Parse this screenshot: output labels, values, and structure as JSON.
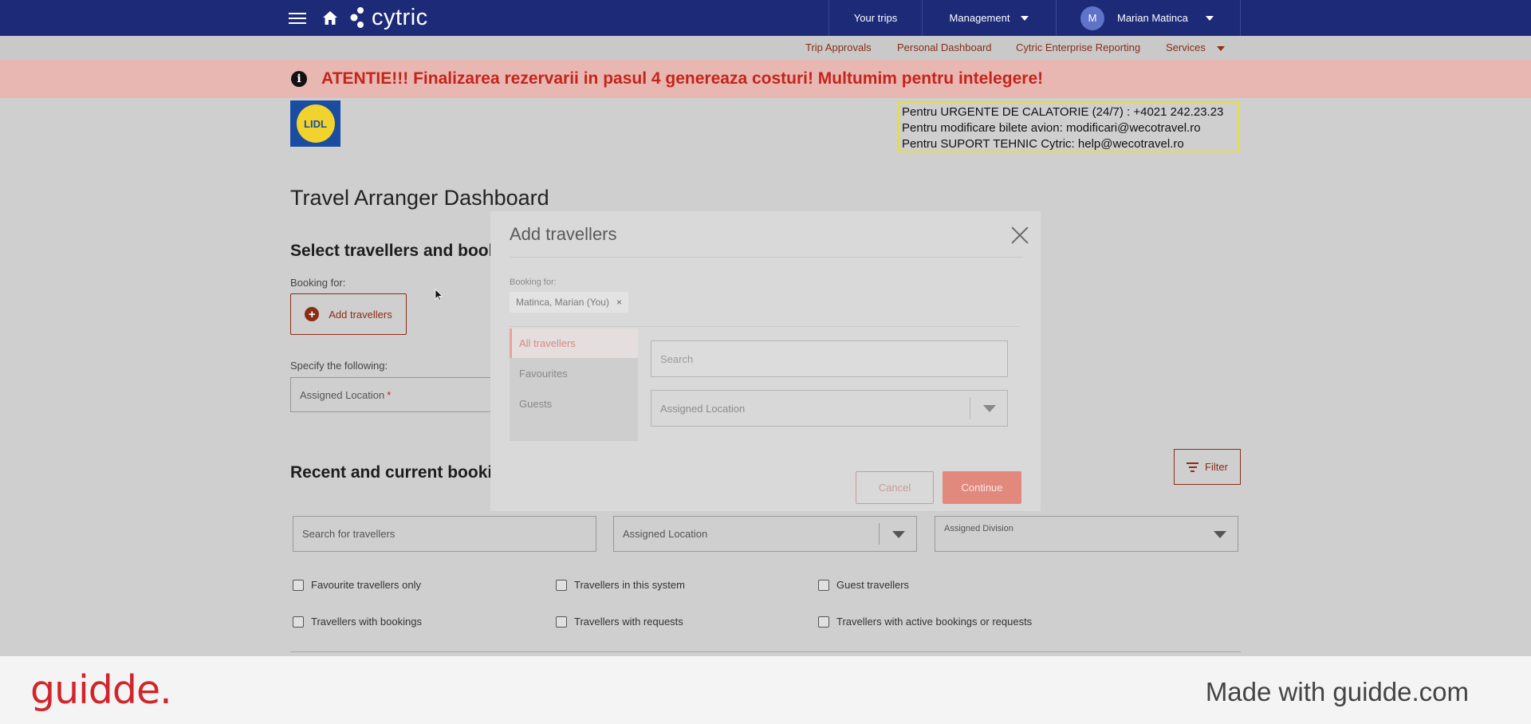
{
  "topbar": {
    "brand": "cytric",
    "your_trips": "Your trips",
    "management": "Management",
    "avatar_initial": "M",
    "user_name": "Marian Matinca"
  },
  "subnav": {
    "trip_approvals": "Trip Approvals",
    "personal_dashboard": "Personal Dashboard",
    "enterprise_reporting": "Cytric Enterprise Reporting",
    "services": "Services"
  },
  "banner": {
    "icon": "i",
    "text": "ATENTIE!!! Finalizarea rezervarii in pasul 4 genereaza costuri! Multumim pentru intelegere!"
  },
  "company": {
    "logo_text": "LIDL"
  },
  "contact": {
    "line1": "Pentru URGENTE DE CALATORIE (24/7) : +4021 242.23.23",
    "line2": "Pentru modificare bilete avion:  modificari@wecotravel.ro",
    "line3": "Pentru SUPORT TEHNIC Cytric:  help@wecotravel.ro"
  },
  "page": {
    "title": "Travel Arranger Dashboard",
    "select_section": "Select travellers and booking type",
    "booking_for": "Booking for:",
    "add_travellers": "Add travellers",
    "specify": "Specify the following:",
    "assigned_location": "Assigned Location",
    "required_mark": "*",
    "recent_section": "Recent and current bookings",
    "filter": "Filter"
  },
  "filters": {
    "search_placeholder": "Search for travellers",
    "assigned_location": "Assigned Location",
    "assigned_division": "Assigned Division",
    "checkboxes": [
      "Favourite travellers only",
      "Travellers in this system",
      "Guest travellers",
      "Travellers with bookings",
      "Travellers with requests",
      "Travellers with active bookings or requests"
    ]
  },
  "modal": {
    "title": "Add travellers",
    "booking_for": "Booking for:",
    "chip": "Matinca, Marian (You)",
    "chip_remove": "×",
    "tabs": [
      "All travellers",
      "Favourites",
      "Guests"
    ],
    "active_tab": "All travellers",
    "search_placeholder": "Search",
    "assigned_location": "Assigned Location",
    "cancel": "Cancel",
    "continue": "Continue"
  },
  "footer": {
    "logo": "guidde.",
    "made_with": "Made with guidde.com"
  },
  "colors": {
    "nav_bg": "#1c2a78",
    "accent": "#8a2d16",
    "banner_text": "#c5241a",
    "guidde_red": "#d0262b"
  }
}
